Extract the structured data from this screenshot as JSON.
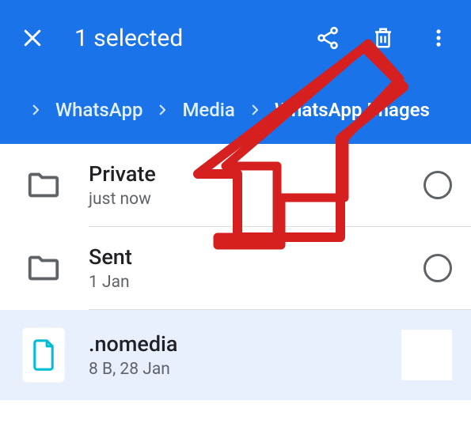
{
  "header": {
    "title": "1 selected"
  },
  "breadcrumb": {
    "items": [
      "WhatsApp",
      "Media",
      "WhatsApp Images"
    ]
  },
  "list": {
    "items": [
      {
        "kind": "folder",
        "name": "Private",
        "subtitle": "just now",
        "selected": false
      },
      {
        "kind": "folder",
        "name": "Sent",
        "subtitle": "1 Jan",
        "selected": false
      },
      {
        "kind": "file",
        "name": ".nomedia",
        "subtitle": "8 B, 28 Jan",
        "selected": true
      }
    ]
  },
  "icons": {
    "close": "close-icon",
    "share": "share-icon",
    "delete": "trash-icon",
    "more": "more-vert-icon",
    "chevron": "chevron-right-icon",
    "folder": "folder-outline-icon",
    "file": "file-outline-icon",
    "radio": "radio-unchecked-icon"
  },
  "colors": {
    "primary": "#1a73e8",
    "accent_file": "#00bcd4",
    "annotation": "#d61f1f"
  }
}
